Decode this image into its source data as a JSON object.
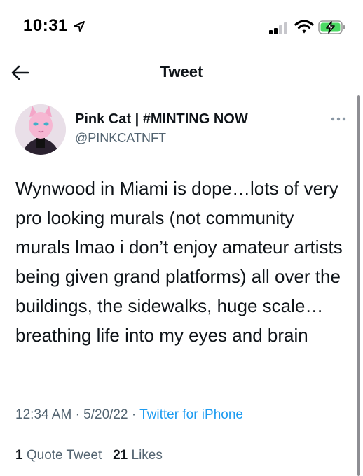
{
  "status_bar": {
    "time": "10:31",
    "location_icon": "location-arrow-icon",
    "signal_icon": "cellular-signal-icon",
    "wifi_icon": "wifi-icon",
    "battery_icon": "battery-charging-icon",
    "battery_color": "#4cd964"
  },
  "nav": {
    "back_icon": "back-arrow-icon",
    "title": "Tweet"
  },
  "tweet": {
    "author_name": "Pink Cat | #MINTING NOW",
    "author_handle": "@PINKCATNFT",
    "avatar_icon": "pink-cat-avatar",
    "more_icon": "more-dots-icon",
    "text": "Wynwood in Miami is dope…lots of very pro looking murals (not community murals lmao i don’t enjoy amateur artists being given grand platforms) all over the buildings, the sidewalks, huge scale…breathing life into my eyes and brain",
    "time": "12:34 AM",
    "date": "5/20/22",
    "separator": "·",
    "source": "Twitter for iPhone",
    "quote_count": "1",
    "quote_label": "Quote Tweet",
    "like_count": "21",
    "like_label": "Likes"
  },
  "colors": {
    "link": "#1d9bf0",
    "secondary_text": "#536471",
    "primary_text": "#0f1419"
  }
}
